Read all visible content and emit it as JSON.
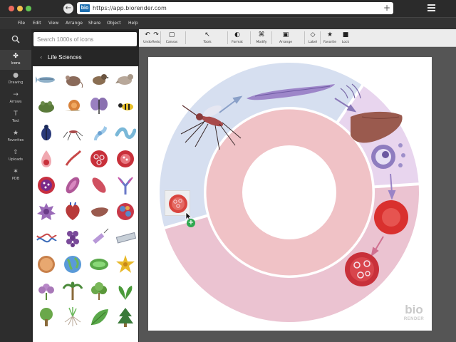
{
  "browser": {
    "url": "https://app.biorender.com",
    "logo_text": "bio",
    "back_glyph": "←",
    "new_tab_glyph": "+"
  },
  "menu": [
    "File",
    "Edit",
    "View",
    "Arrange",
    "Share",
    "Object",
    "Help"
  ],
  "rail": {
    "items": [
      {
        "label": "Icons",
        "icon": "✤",
        "icon_name": "icons-icon"
      },
      {
        "label": "Drawing",
        "icon": "●",
        "icon_name": "drawing-icon"
      },
      {
        "label": "Arrows",
        "icon": "→",
        "icon_name": "arrows-icon"
      },
      {
        "label": "Text",
        "icon": "T",
        "icon_name": "text-icon"
      },
      {
        "label": "Favorites",
        "icon": "★",
        "icon_name": "star-icon"
      },
      {
        "label": "Uploads",
        "icon": "⇧",
        "icon_name": "upload-icon"
      },
      {
        "label": "PDB",
        "icon": "✶",
        "icon_name": "pdb-icon"
      }
    ]
  },
  "panel": {
    "search_placeholder": "Search 1000s of icons",
    "category": "Life Sciences",
    "category_chevron": "‹",
    "icons": [
      "zebrafish",
      "mouse",
      "sparrow",
      "dove",
      "frog",
      "snail",
      "butterfly",
      "wasp",
      "beetle",
      "mosquito",
      "hair-cell",
      "worm",
      "droplet-cell",
      "sperm",
      "red-blood-cell-infected",
      "red-blood-cell-spotted",
      "cell-with-granules",
      "sickle-cell",
      "muscle-cell",
      "antibody",
      "macrophage",
      "heart",
      "liver",
      "protein-complex",
      "dna",
      "grapes-cluster",
      "syringe",
      "microscope-slide",
      "cookie-cell",
      "globe",
      "chloroplast",
      "flower-star",
      "purple-flower",
      "palm-tree",
      "shrub",
      "leafy-plant",
      "tree",
      "grass-roots",
      "leaf",
      "pine-tree"
    ]
  },
  "toolbar": {
    "groups": [
      {
        "label": "Undo",
        "glyph": "↶"
      },
      {
        "label": "Redo",
        "glyph": "↷"
      },
      {
        "label": "Canvas",
        "glyph": "▢"
      },
      {
        "label": "Tools",
        "glyph": "↖"
      },
      {
        "label": "Format",
        "glyph": "◐"
      },
      {
        "label": "Modify",
        "glyph": "⌘"
      },
      {
        "label": "Arrange",
        "glyph": "▣"
      },
      {
        "label": "Label",
        "glyph": "◇"
      },
      {
        "label": "Favorite",
        "glyph": "★"
      },
      {
        "label": "Lock",
        "glyph": "■"
      }
    ]
  },
  "diagram": {
    "ring_colors": {
      "top_sector": "#e8d5ee",
      "left_sector": "#d6dff0",
      "bottom_sector": "#ebc3d1",
      "inner_ring": "#f0c2c6",
      "center": "#ffffff"
    }
  },
  "watermark": {
    "top": "bio",
    "bottom": "RENDER"
  },
  "drag": {
    "add_glyph": "+"
  }
}
